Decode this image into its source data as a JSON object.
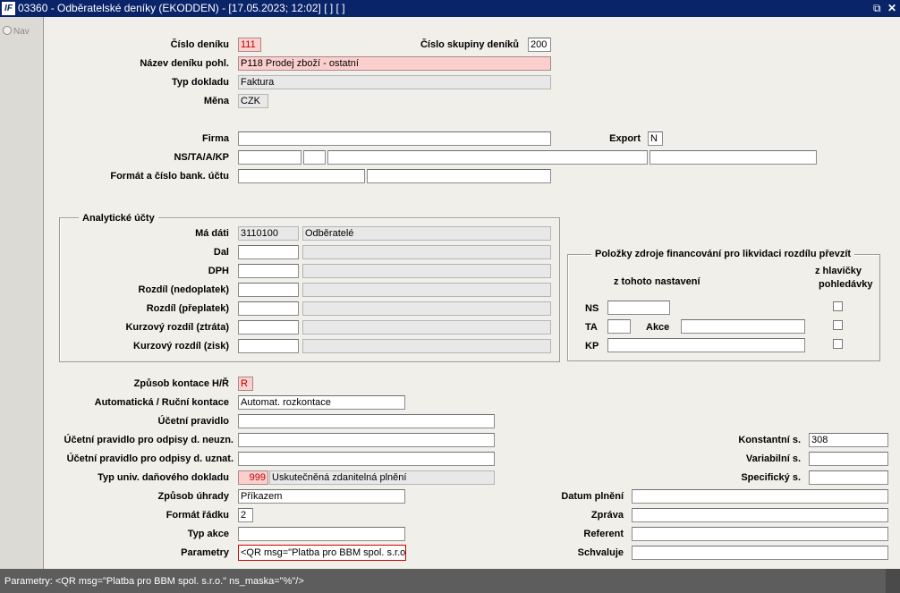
{
  "window": {
    "title": "03360 - Odběratelské deníky (EKODDEN) - [17.05.2023; 12:02]  [ ]  [ ]",
    "logo": "IF",
    "restore_icon": "restore-icon",
    "close_icon": "close-icon"
  },
  "left_nav": {
    "label": "Nav"
  },
  "header": {
    "cislo_deniku": {
      "label": "Číslo deníku",
      "value": "111"
    },
    "cislo_skupiny": {
      "label": "Číslo skupiny deníků",
      "value": "200"
    },
    "nazev": {
      "label": "Název deníku pohl.",
      "value": "P118 Prodej zboží - ostatní"
    },
    "typ_dokladu": {
      "label": "Typ dokladu",
      "value": "Faktura"
    },
    "mena": {
      "label": "Měna",
      "value": "CZK"
    },
    "firma": {
      "label": "Firma",
      "value": ""
    },
    "export": {
      "label": "Export",
      "value": "N"
    },
    "ns_ta": {
      "label": "NS/TA/A/KP",
      "values": [
        "",
        "",
        "",
        ""
      ]
    },
    "bank": {
      "label": "Formát a číslo bank. účtu",
      "values": [
        "",
        ""
      ]
    }
  },
  "analyticke": {
    "title": "Analytické účty",
    "rows": [
      {
        "label": "Má dáti",
        "code": "3110100",
        "name": "Odběratelé"
      },
      {
        "label": "Dal",
        "code": "",
        "name": ""
      },
      {
        "label": "DPH",
        "code": "",
        "name": ""
      },
      {
        "label": "Rozdíl (nedoplatek)",
        "code": "",
        "name": ""
      },
      {
        "label": "Rozdíl (přeplatek)",
        "code": "",
        "name": ""
      },
      {
        "label": "Kurzový rozdíl (ztráta)",
        "code": "",
        "name": ""
      },
      {
        "label": "Kurzový rozdíl (zisk)",
        "code": "",
        "name": ""
      }
    ]
  },
  "polozky": {
    "title": "Položky zdroje financování pro likvidaci rozdílu převzít",
    "col1": "z tohoto nastavení",
    "col2_line1": "z hlavičky",
    "col2_line2": "pohledávky",
    "ns_label": "NS",
    "ta_label": "TA",
    "akce_label": "Akce",
    "kp_label": "KP"
  },
  "kontace": {
    "zpusob": {
      "label": "Způsob kontace H/Ř",
      "value": "R"
    },
    "auto": {
      "label": "Automatická / Ruční kontace",
      "value": "Automat. rozkontace"
    },
    "ucetni": {
      "label": "Účetní pravidlo",
      "value": ""
    },
    "neuzn": {
      "label": "Účetní pravidlo pro odpisy d. neuzn.",
      "value": ""
    },
    "uzn": {
      "label": "Účetní pravidlo pro odpisy d. uznat.",
      "value": ""
    },
    "typ_univ": {
      "label": "Typ univ. daňového dokladu",
      "code": "999",
      "name": "Uskutečněná zdanitelná plnění"
    },
    "uhrada": {
      "label": "Způsob úhrady",
      "value": "Příkazem"
    },
    "format_radku": {
      "label": "Formát řádku",
      "value": "2"
    },
    "typ_akce": {
      "label": "Typ akce",
      "value": ""
    },
    "parametry": {
      "label": "Parametry",
      "value": "<QR msg=\"Platba pro BBM spol. s.r.o.\""
    }
  },
  "symbols": {
    "konstantni": {
      "label": "Konstantní s.",
      "value": "308"
    },
    "variabilni": {
      "label": "Variabilní s.",
      "value": ""
    },
    "specificky": {
      "label": "Specifický s.",
      "value": ""
    },
    "datum": {
      "label": "Datum plnění",
      "value": ""
    },
    "zprava": {
      "label": "Zpráva",
      "value": ""
    },
    "referent": {
      "label": "Referent",
      "value": ""
    },
    "schvaluje": {
      "label": "Schvaluje",
      "value": ""
    }
  },
  "status": {
    "text": "Parametry: <QR msg=\"Platba pro BBM spol. s.r.o.\" ns_maska=\"%\"/>"
  }
}
